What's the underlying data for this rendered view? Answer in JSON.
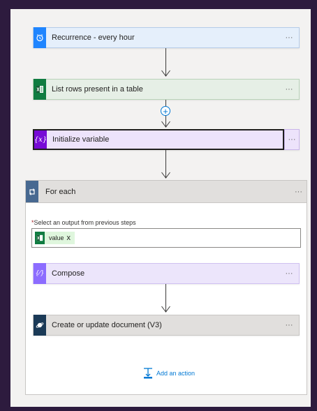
{
  "flow": {
    "steps": [
      {
        "title": "Recurrence - every hour",
        "more": "···",
        "accent": "#1f85ff",
        "icon": "alarm-clock-icon"
      },
      {
        "title": "List rows present in a table",
        "more": "···",
        "accent": "#107c41",
        "icon": "excel-icon"
      },
      {
        "title": "Initialize variable",
        "more": "···",
        "accent": "#770bd6",
        "icon": "variable-icon"
      }
    ],
    "add_step_symbol": "+",
    "foreach": {
      "title": "For each",
      "more": "···",
      "icon": "loop-icon",
      "output_label_required": "*",
      "output_label": "Select an output from previous steps",
      "token_label": "value",
      "token_remove": "x",
      "actions": [
        {
          "title": "Compose",
          "more": "···",
          "accent": "#8c6cff",
          "icon": "compose-icon"
        },
        {
          "title": "Create or update document (V3)",
          "more": "···",
          "accent": "#1b3a57",
          "icon": "cosmos-db-icon"
        }
      ],
      "add_action_label": "Add an action"
    }
  }
}
